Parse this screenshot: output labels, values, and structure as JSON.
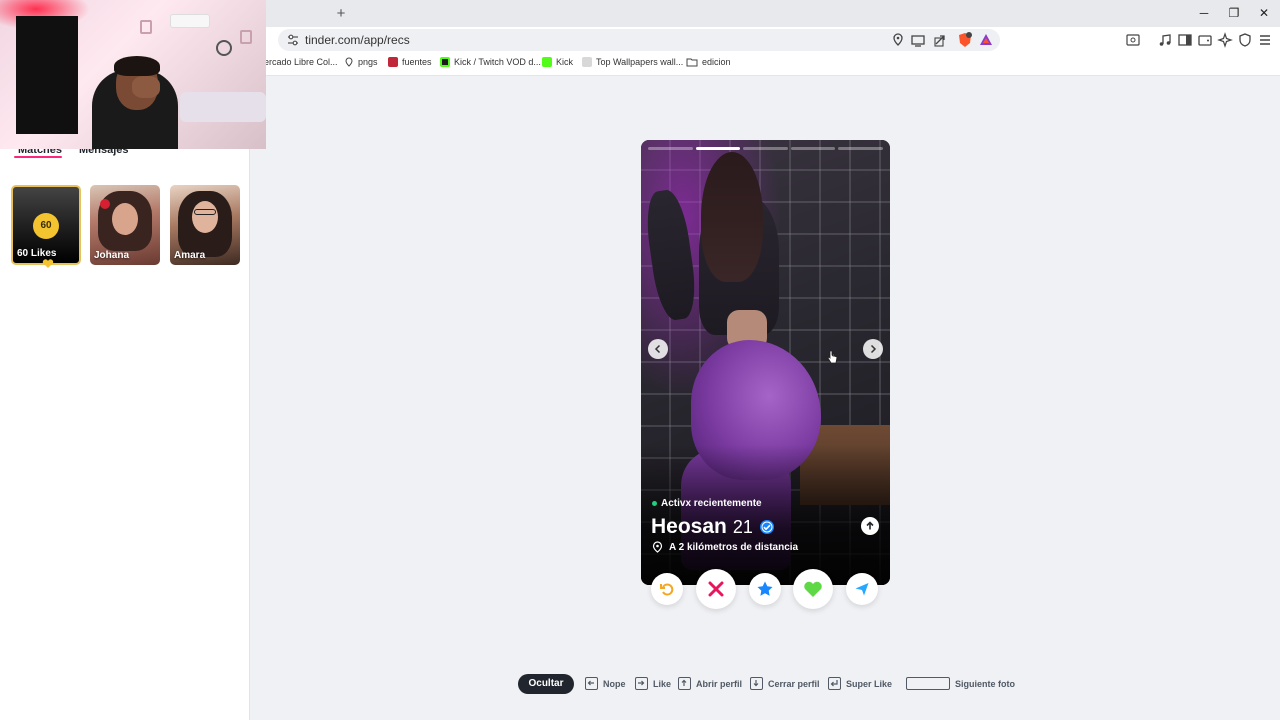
{
  "browser": {
    "new_tab_label": "+",
    "url": "tinder.com/app/recs",
    "window_controls": {
      "minimize": "─",
      "restore": "❐",
      "close": "✕"
    },
    "bookmarks": [
      {
        "label": "ercado Libre Col...",
        "icon": "mercadolibre-icon"
      },
      {
        "label": "pngs",
        "icon": "pin-icon"
      },
      {
        "label": "fuentes",
        "icon": "font-icon"
      },
      {
        "label": "Kick / Twitch VOD d...",
        "icon": "kick-icon"
      },
      {
        "label": "Kick",
        "icon": "kick-icon"
      },
      {
        "label": "Top Wallpapers wall...",
        "icon": "wallpaper-icon"
      },
      {
        "label": "edicion",
        "icon": "folder-icon"
      }
    ]
  },
  "sidebar": {
    "tabs": [
      {
        "label": "Matches",
        "active": true
      },
      {
        "label": "Mensajes",
        "active": false
      }
    ],
    "likes_card": {
      "count": "60",
      "label": "60 Likes"
    },
    "matches": [
      {
        "name": "Johana"
      },
      {
        "name": "Amara"
      }
    ]
  },
  "profile": {
    "photo_count": 5,
    "active_photo": 2,
    "status": "Activx recientemente",
    "name": "Heosan",
    "age": "21",
    "verified": true,
    "distance": "A 2 kilómetros de distancia"
  },
  "actions": [
    {
      "name": "rewind",
      "icon": "rewind-icon",
      "color": "#f5a623"
    },
    {
      "name": "nope",
      "icon": "x-icon",
      "color": "#e8175d"
    },
    {
      "name": "super-like",
      "icon": "star-icon",
      "color": "#1786ff"
    },
    {
      "name": "like",
      "icon": "heart-icon",
      "color": "#5fd845"
    },
    {
      "name": "boost",
      "icon": "send-icon",
      "color": "#26a8ff"
    }
  ],
  "shortcuts": {
    "hide_label": "Ocultar",
    "nope": "Nope",
    "like": "Like",
    "open_profile": "Abrir perfil",
    "close_profile": "Cerrar perfil",
    "super_like": "Super Like",
    "next_photo": "Siguiente foto"
  },
  "colors": {
    "brand": "#fd267d",
    "gold": "#f4c430",
    "dark": "#21262e",
    "background": "#f0f1f4"
  }
}
